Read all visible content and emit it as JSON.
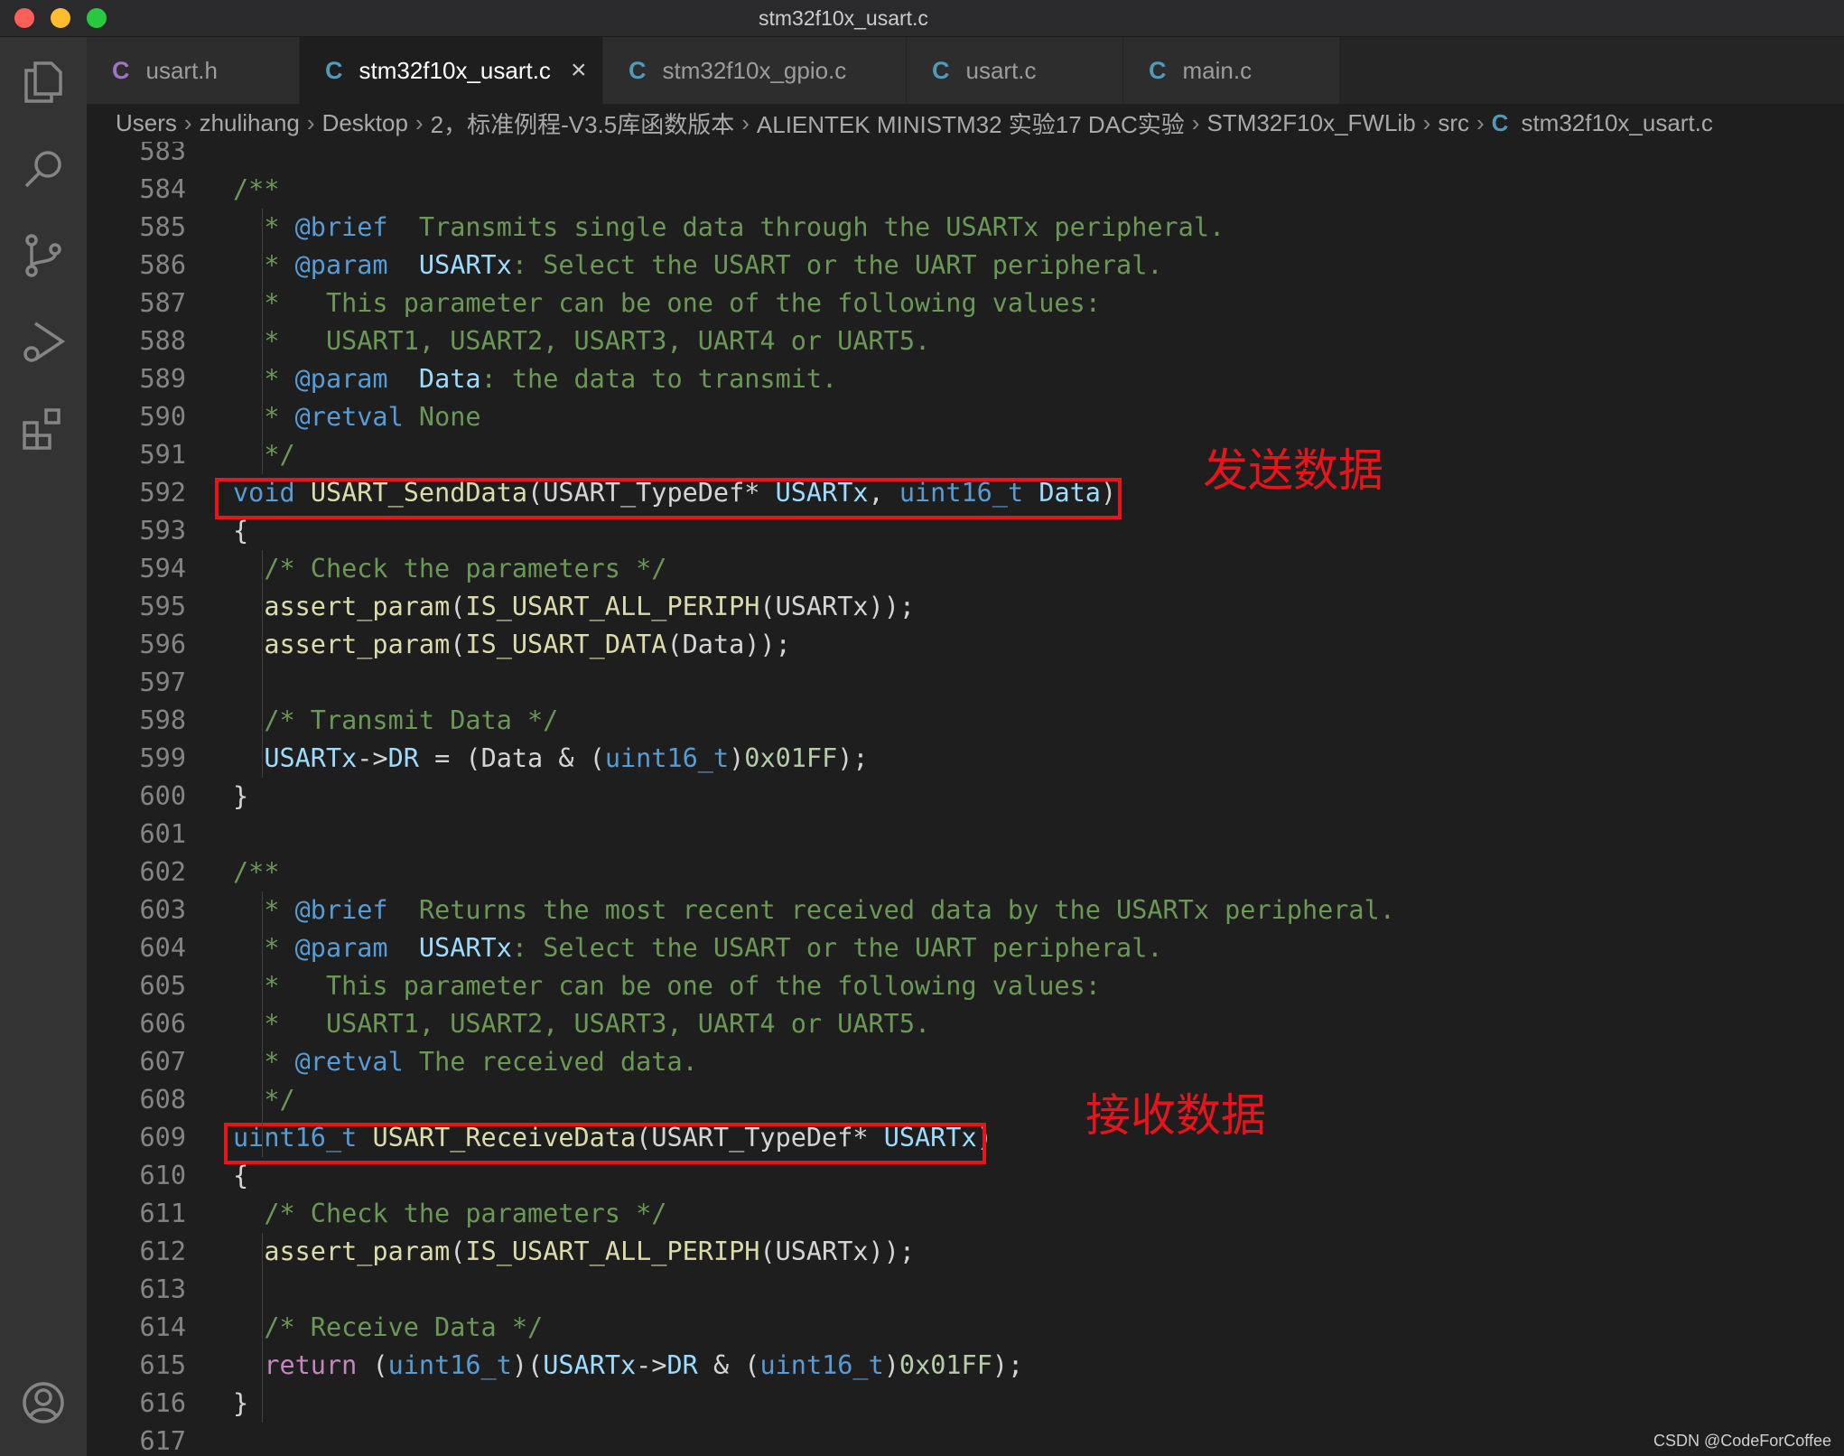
{
  "window": {
    "title": "stm32f10x_usart.c"
  },
  "tabs": [
    {
      "icon": "C",
      "label": "usart.h",
      "active": false
    },
    {
      "icon": "C",
      "label": "stm32f10x_usart.c",
      "active": true
    },
    {
      "icon": "C",
      "label": "stm32f10x_gpio.c",
      "active": false
    },
    {
      "icon": "C",
      "label": "usart.c",
      "active": false
    },
    {
      "icon": "C",
      "label": "main.c",
      "active": false
    }
  ],
  "breadcrumb": [
    "Users",
    "zhulihang",
    "Desktop",
    "2，标准例程-V3.5库函数版本",
    "ALIENTEK MINISTM32 实验17 DAC实验",
    "STM32F10x_FWLib",
    "src",
    "stm32f10x_usart.c"
  ],
  "breadcrumb_file_icon": "C",
  "editor": {
    "lines": [
      {
        "n": "583",
        "parts": []
      },
      {
        "n": "584",
        "parts": [
          {
            "t": "/**",
            "c": "com"
          }
        ]
      },
      {
        "n": "585",
        "parts": [
          {
            "t": "  * ",
            "c": "com"
          },
          {
            "t": "@brief",
            "c": "tag"
          },
          {
            "t": "  Transmits single data through the USARTx peripheral.",
            "c": "com"
          }
        ]
      },
      {
        "n": "586",
        "parts": [
          {
            "t": "  * ",
            "c": "com"
          },
          {
            "t": "@param",
            "c": "tag"
          },
          {
            "t": "  ",
            "c": "com"
          },
          {
            "t": "USARTx",
            "c": "var"
          },
          {
            "t": ": Select the USART or the UART peripheral.",
            "c": "com"
          }
        ]
      },
      {
        "n": "587",
        "parts": [
          {
            "t": "  *   This parameter can be one of the following values:",
            "c": "com"
          }
        ]
      },
      {
        "n": "588",
        "parts": [
          {
            "t": "  *   USART1, USART2, USART3, UART4 or UART5.",
            "c": "com"
          }
        ]
      },
      {
        "n": "589",
        "parts": [
          {
            "t": "  * ",
            "c": "com"
          },
          {
            "t": "@param",
            "c": "tag"
          },
          {
            "t": "  ",
            "c": "com"
          },
          {
            "t": "Data",
            "c": "var"
          },
          {
            "t": ": the data to transmit.",
            "c": "com"
          }
        ]
      },
      {
        "n": "590",
        "parts": [
          {
            "t": "  * ",
            "c": "com"
          },
          {
            "t": "@retval",
            "c": "tag"
          },
          {
            "t": " None",
            "c": "com"
          }
        ]
      },
      {
        "n": "591",
        "parts": [
          {
            "t": "  */",
            "c": "com"
          }
        ]
      },
      {
        "n": "592",
        "parts": [
          {
            "t": "void",
            "c": "kw"
          },
          {
            "t": " ",
            "c": "txt"
          },
          {
            "t": "USART_SendData",
            "c": "fn"
          },
          {
            "t": "(USART_TypeDef* ",
            "c": "txt"
          },
          {
            "t": "USARTx",
            "c": "var"
          },
          {
            "t": ", ",
            "c": "txt"
          },
          {
            "t": "uint16_t",
            "c": "kw"
          },
          {
            "t": " ",
            "c": "txt"
          },
          {
            "t": "Data",
            "c": "var"
          },
          {
            "t": ")",
            "c": "txt"
          }
        ]
      },
      {
        "n": "593",
        "parts": [
          {
            "t": "{",
            "c": "txt"
          }
        ]
      },
      {
        "n": "594",
        "parts": [
          {
            "t": "  /* Check the parameters */",
            "c": "com"
          }
        ]
      },
      {
        "n": "595",
        "parts": [
          {
            "t": "  ",
            "c": "txt"
          },
          {
            "t": "assert_param",
            "c": "fn"
          },
          {
            "t": "(",
            "c": "txt"
          },
          {
            "t": "IS_USART_ALL_PERIPH",
            "c": "fn"
          },
          {
            "t": "(USARTx));",
            "c": "txt"
          }
        ]
      },
      {
        "n": "596",
        "parts": [
          {
            "t": "  ",
            "c": "txt"
          },
          {
            "t": "assert_param",
            "c": "fn"
          },
          {
            "t": "(",
            "c": "txt"
          },
          {
            "t": "IS_USART_DATA",
            "c": "fn"
          },
          {
            "t": "(Data));",
            "c": "txt"
          }
        ]
      },
      {
        "n": "597",
        "parts": []
      },
      {
        "n": "598",
        "parts": [
          {
            "t": "  /* Transmit Data */",
            "c": "com"
          }
        ]
      },
      {
        "n": "599",
        "parts": [
          {
            "t": "  ",
            "c": "txt"
          },
          {
            "t": "USARTx",
            "c": "var"
          },
          {
            "t": "->",
            "c": "txt"
          },
          {
            "t": "DR",
            "c": "var"
          },
          {
            "t": " = (Data & (",
            "c": "txt"
          },
          {
            "t": "uint16_t",
            "c": "kw"
          },
          {
            "t": ")",
            "c": "txt"
          },
          {
            "t": "0x01FF",
            "c": "num"
          },
          {
            "t": ");",
            "c": "txt"
          }
        ]
      },
      {
        "n": "600",
        "parts": [
          {
            "t": "}",
            "c": "txt"
          }
        ]
      },
      {
        "n": "601",
        "parts": []
      },
      {
        "n": "602",
        "parts": [
          {
            "t": "/**",
            "c": "com"
          }
        ]
      },
      {
        "n": "603",
        "parts": [
          {
            "t": "  * ",
            "c": "com"
          },
          {
            "t": "@brief",
            "c": "tag"
          },
          {
            "t": "  Returns the most recent received data by the USARTx peripheral.",
            "c": "com"
          }
        ]
      },
      {
        "n": "604",
        "parts": [
          {
            "t": "  * ",
            "c": "com"
          },
          {
            "t": "@param",
            "c": "tag"
          },
          {
            "t": "  ",
            "c": "com"
          },
          {
            "t": "USARTx",
            "c": "var"
          },
          {
            "t": ": Select the USART or the UART peripheral.",
            "c": "com"
          }
        ]
      },
      {
        "n": "605",
        "parts": [
          {
            "t": "  *   This parameter can be one of the following values:",
            "c": "com"
          }
        ]
      },
      {
        "n": "606",
        "parts": [
          {
            "t": "  *   USART1, USART2, USART3, UART4 or UART5.",
            "c": "com"
          }
        ]
      },
      {
        "n": "607",
        "parts": [
          {
            "t": "  * ",
            "c": "com"
          },
          {
            "t": "@retval",
            "c": "tag"
          },
          {
            "t": " The received data.",
            "c": "com"
          }
        ]
      },
      {
        "n": "608",
        "parts": [
          {
            "t": "  */",
            "c": "com"
          }
        ]
      },
      {
        "n": "609",
        "parts": [
          {
            "t": "uint16_t",
            "c": "kw"
          },
          {
            "t": " ",
            "c": "txt"
          },
          {
            "t": "USART_ReceiveData",
            "c": "fn"
          },
          {
            "t": "(USART_TypeDef* ",
            "c": "txt"
          },
          {
            "t": "USARTx",
            "c": "var"
          },
          {
            "t": ")",
            "c": "txt"
          }
        ]
      },
      {
        "n": "610",
        "parts": [
          {
            "t": "{",
            "c": "txt"
          }
        ]
      },
      {
        "n": "611",
        "parts": [
          {
            "t": "  /* Check the parameters */",
            "c": "com"
          }
        ]
      },
      {
        "n": "612",
        "parts": [
          {
            "t": "  ",
            "c": "txt"
          },
          {
            "t": "assert_param",
            "c": "fn"
          },
          {
            "t": "(",
            "c": "txt"
          },
          {
            "t": "IS_USART_ALL_PERIPH",
            "c": "fn"
          },
          {
            "t": "(USARTx));",
            "c": "txt"
          }
        ]
      },
      {
        "n": "613",
        "parts": []
      },
      {
        "n": "614",
        "parts": [
          {
            "t": "  /* Receive Data */",
            "c": "com"
          }
        ]
      },
      {
        "n": "615",
        "parts": [
          {
            "t": "  ",
            "c": "txt"
          },
          {
            "t": "return",
            "c": "ctl"
          },
          {
            "t": " (",
            "c": "txt"
          },
          {
            "t": "uint16_t",
            "c": "kw"
          },
          {
            "t": ")(",
            "c": "txt"
          },
          {
            "t": "USARTx",
            "c": "var"
          },
          {
            "t": "->",
            "c": "txt"
          },
          {
            "t": "DR",
            "c": "var"
          },
          {
            "t": " & (",
            "c": "txt"
          },
          {
            "t": "uint16_t",
            "c": "kw"
          },
          {
            "t": ")",
            "c": "txt"
          },
          {
            "t": "0x01FF",
            "c": "num"
          },
          {
            "t": ");",
            "c": "txt"
          }
        ]
      },
      {
        "n": "616",
        "parts": [
          {
            "t": "}",
            "c": "txt"
          }
        ]
      },
      {
        "n": "617",
        "parts": []
      }
    ]
  },
  "annotations": {
    "send_label": "发送数据",
    "receive_label": "接收数据",
    "color": "#e8141c"
  },
  "watermark": "CSDN @CodeForCoffee",
  "activity_icons": [
    "explorer-icon",
    "search-icon",
    "source-control-icon",
    "run-debug-icon",
    "extensions-icon",
    "account-icon"
  ]
}
